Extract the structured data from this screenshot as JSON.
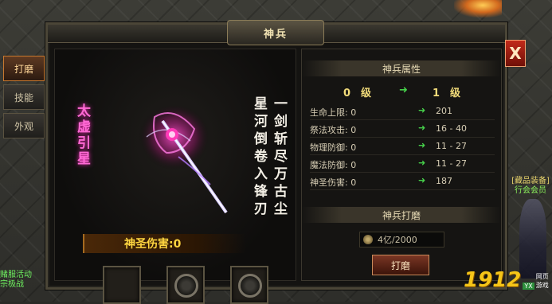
{
  "window": {
    "title": "神兵",
    "close_label": "X"
  },
  "tabs": [
    {
      "label": "打磨",
      "active": true
    },
    {
      "label": "技能",
      "active": false
    },
    {
      "label": "外观",
      "active": false
    }
  ],
  "weapon": {
    "name": "太虚引星",
    "poem_line1": "一剑斩尽万古尘",
    "poem_line2": "星河倒卷入锋刃",
    "damage_label": "神圣伤害:0"
  },
  "slots": [
    "empty",
    "gem",
    "gem"
  ],
  "attributes": {
    "title": "神兵属性",
    "from_level": "0　级",
    "to_level": "1　级",
    "arrow": "➜",
    "rows": [
      {
        "label": "生命上限: 0",
        "next": "201"
      },
      {
        "label": "祭法攻击: 0",
        "next": "16 - 40"
      },
      {
        "label": "物理防御: 0",
        "next": "11 - 27"
      },
      {
        "label": "魔法防御: 0",
        "next": "11 - 27"
      },
      {
        "label": "神圣伤害: 0",
        "next": "187"
      }
    ]
  },
  "polish": {
    "title": "神兵打磨",
    "cost": "4亿/2000",
    "button_label": "打磨"
  },
  "overlays": {
    "left_line1": "赌服活动",
    "left_line2": "宗极战",
    "right_line1": "[藏品装备]",
    "right_line2": "行会会员",
    "logo_number": "1912",
    "logo_tag": "YX",
    "logo_sub": "网页游戏"
  },
  "colors": {
    "accent": "#f5c518",
    "weapon_name": "#ff6ad5",
    "arrow": "#46d04a",
    "damage": "#ffd640"
  }
}
